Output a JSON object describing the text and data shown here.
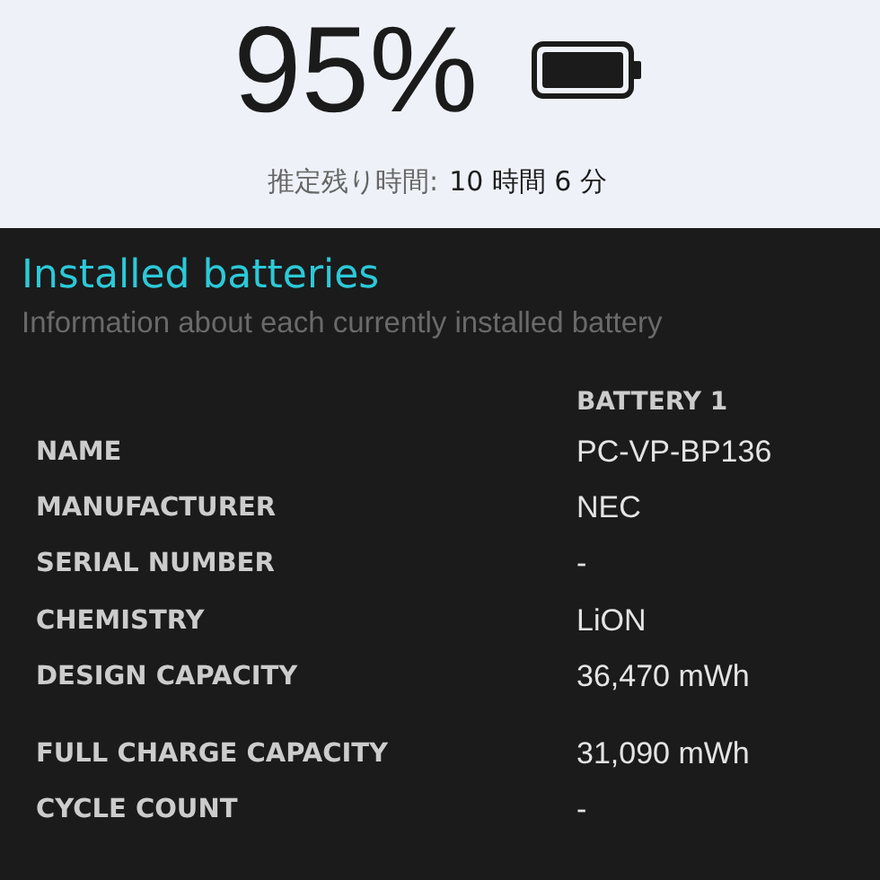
{
  "charge": {
    "percent": "95%",
    "remaining_label": "推定残り時間:",
    "remaining_value": "10 時間 6 分"
  },
  "installed_batteries": {
    "title": "Installed batteries",
    "subtitle": "Information about each currently installed battery",
    "columns": [
      "BATTERY 1"
    ],
    "row_groups": [
      [
        {
          "label": "NAME",
          "value": "PC-VP-BP136"
        },
        {
          "label": "MANUFACTURER",
          "value": "NEC"
        },
        {
          "label": "SERIAL NUMBER",
          "value": "-"
        },
        {
          "label": "CHEMISTRY",
          "value": "LiON"
        },
        {
          "label": "DESIGN CAPACITY",
          "value": "36,470 mWh"
        }
      ],
      [
        {
          "label": "FULL CHARGE CAPACITY",
          "value": "31,090 mWh"
        },
        {
          "label": "CYCLE COUNT",
          "value": "-"
        }
      ]
    ]
  }
}
